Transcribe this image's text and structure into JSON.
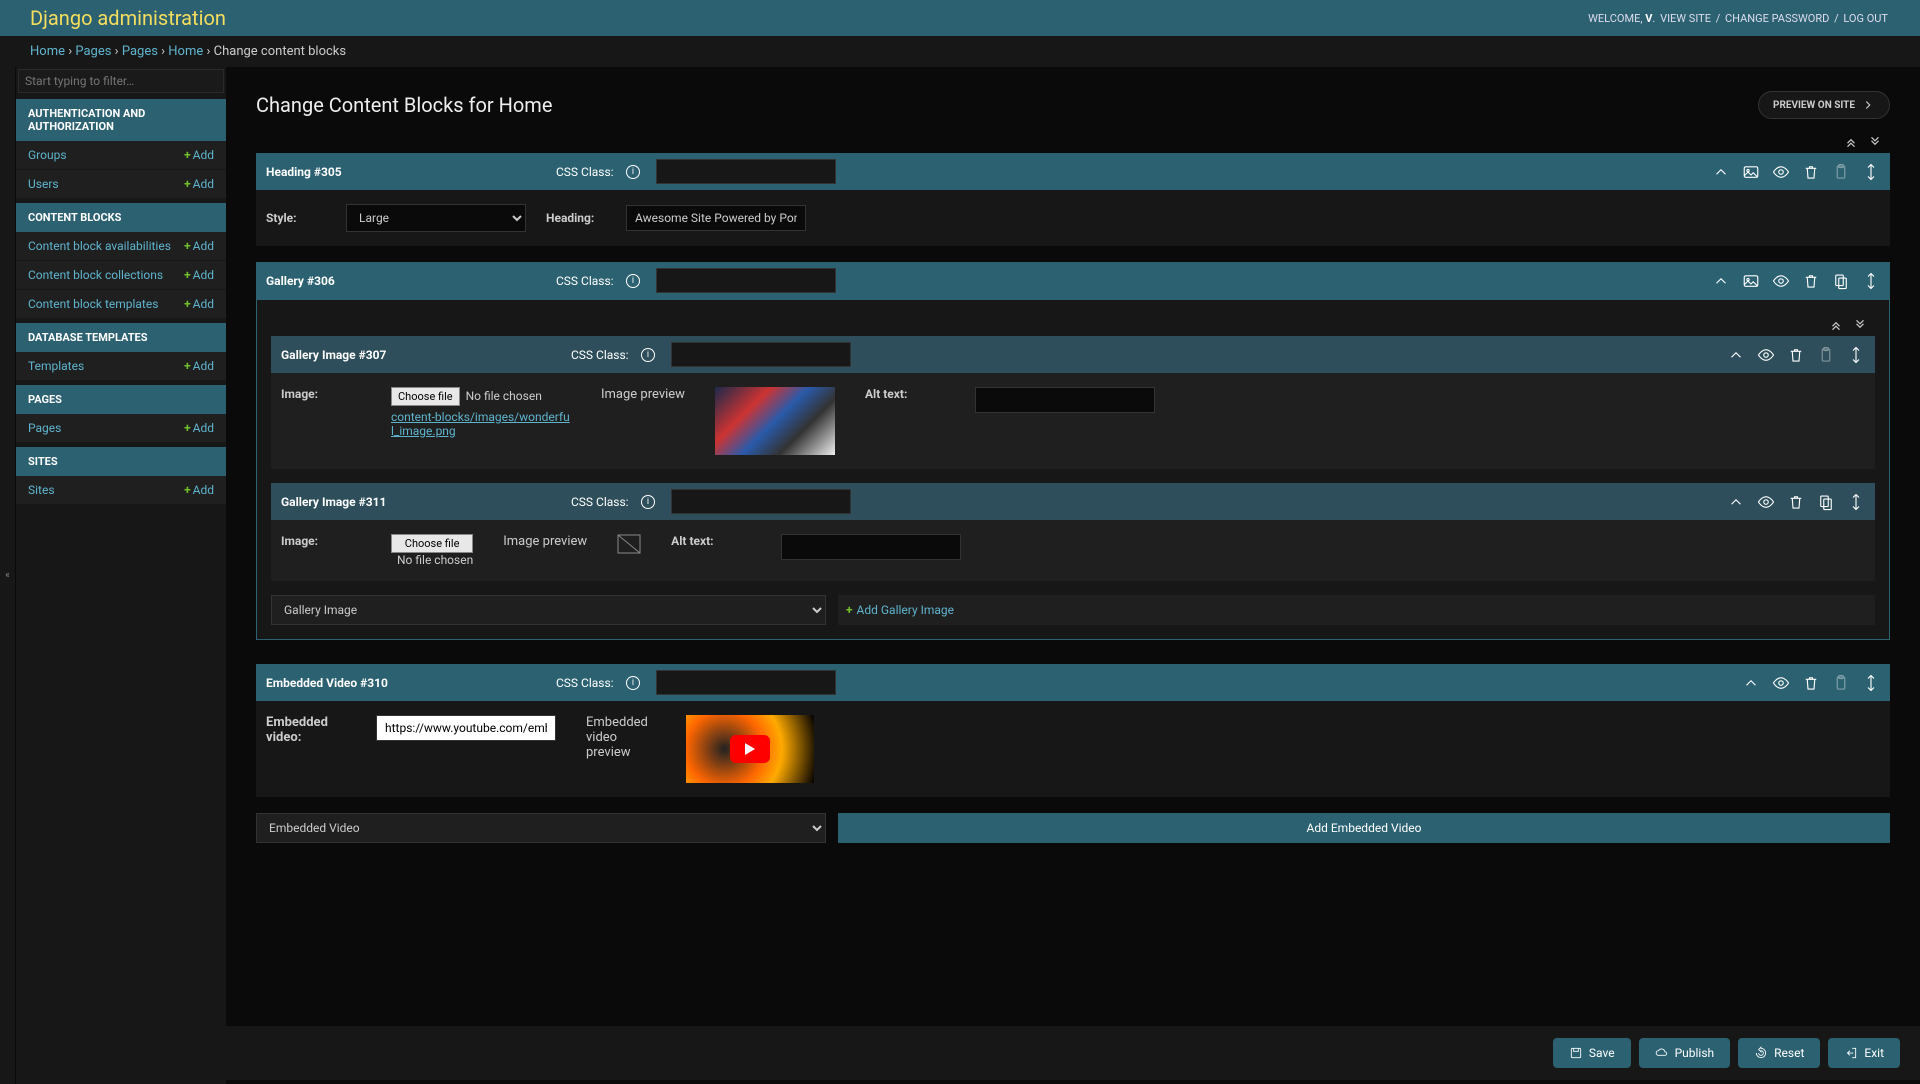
{
  "header": {
    "title": "Django administration",
    "welcome": "WELCOME,",
    "user": "V",
    "view_site": "VIEW SITE",
    "change_pw": "CHANGE PASSWORD",
    "logout": "LOG OUT"
  },
  "breadcrumb": {
    "home": "Home",
    "pages1": "Pages",
    "pages2": "Pages",
    "home2": "Home",
    "current": "Change content blocks"
  },
  "sidebar": {
    "filter_placeholder": "Start typing to filter…",
    "add": "Add",
    "sec_auth": "AUTHENTICATION AND AUTHORIZATION",
    "groups": "Groups",
    "users": "Users",
    "sec_cb": "CONTENT BLOCKS",
    "cba": "Content block availabilities",
    "cbc": "Content block collections",
    "cbt": "Content block templates",
    "sec_db": "DATABASE TEMPLATES",
    "templates": "Templates",
    "sec_pages": "PAGES",
    "pages": "Pages",
    "sec_sites": "SITES",
    "sites": "Sites"
  },
  "page": {
    "title": "Change Content Blocks for Home",
    "preview": "PREVIEW ON SITE"
  },
  "labels": {
    "css_class": "CSS Class:",
    "style": "Style:",
    "heading": "Heading:",
    "image": "Image:",
    "image_preview": "Image preview",
    "alt_text": "Alt text:",
    "embedded_video": "Embedded video:",
    "video_preview": "Embedded video preview",
    "choose_file": "Choose file",
    "no_file": "No file chosen"
  },
  "blocks": {
    "heading305": {
      "title": "Heading #305",
      "style_opt": "Large",
      "heading_val": "Awesome Site Powered by Ponies"
    },
    "gallery306": {
      "title": "Gallery #306"
    },
    "img307": {
      "title": "Gallery Image #307",
      "file_link": "content-blocks/images/wonderful_image.png"
    },
    "img311": {
      "title": "Gallery Image #311"
    },
    "add_gallery_sel": "Gallery Image",
    "add_gallery_btn": "Add Gallery Image",
    "video310": {
      "title": "Embedded Video #310",
      "url": "https://www.youtube.com/embed/RJlSF"
    },
    "add_video_sel": "Embedded Video",
    "add_video_btn": "Add Embedded Video"
  },
  "footer": {
    "save": "Save",
    "publish": "Publish",
    "reset": "Reset",
    "exit": "Exit"
  }
}
